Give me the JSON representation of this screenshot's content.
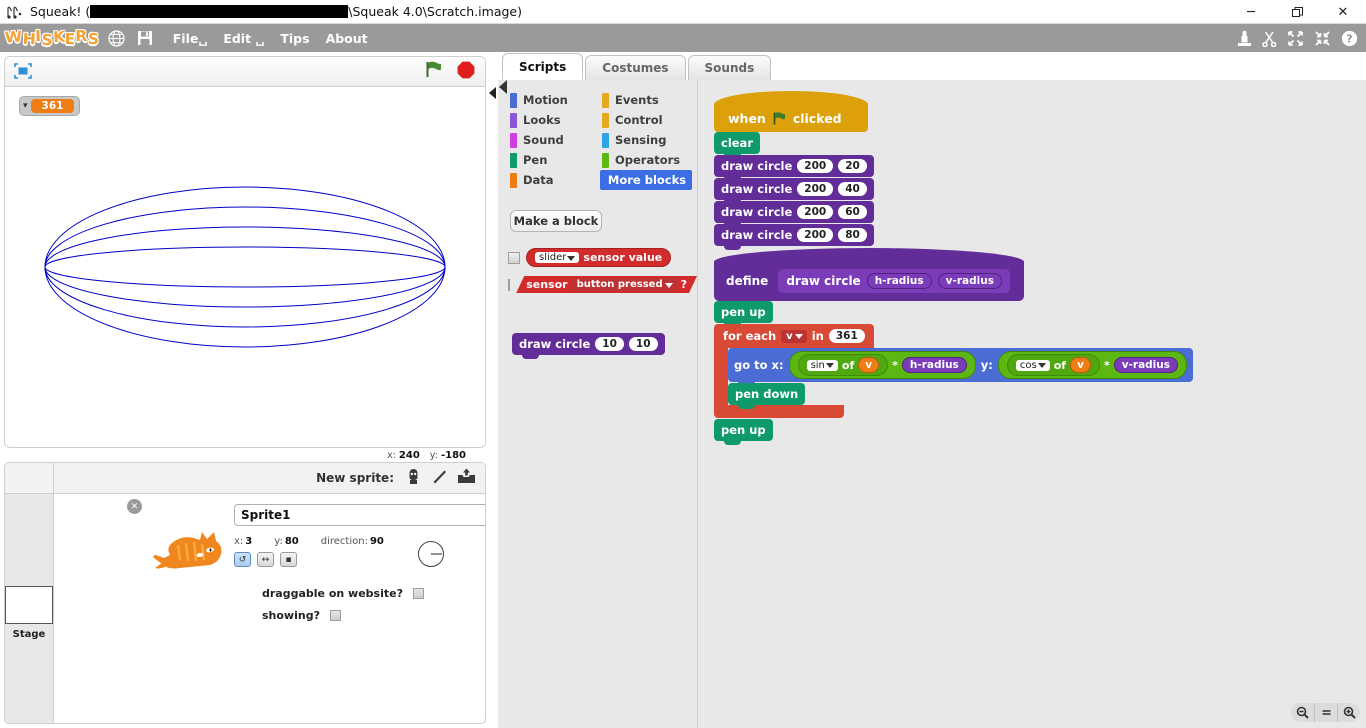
{
  "window": {
    "app_icon": "squeak-icon",
    "title_prefix": "Squeak! (",
    "title_redacted": "",
    "title_suffix": "\\Squeak 4.0\\Scratch.image)",
    "minimize": "─",
    "restore": "❐",
    "close": "✕"
  },
  "menubar": {
    "logo": "WHISKERS",
    "globe_icon": "globe-icon",
    "save_icon": "floppy-disk-icon",
    "items": [
      {
        "label": "File␣"
      },
      {
        "label": "Edit ␣"
      },
      {
        "label": "Tips"
      },
      {
        "label": "About"
      }
    ],
    "tools": [
      {
        "name": "stamp-icon"
      },
      {
        "name": "scissors-icon"
      },
      {
        "name": "grow-icon"
      },
      {
        "name": "shrink-icon"
      },
      {
        "name": "help-icon"
      }
    ]
  },
  "stage": {
    "presentation_icon": "presentation-mode-icon",
    "green_flag_icon": "green-flag-icon",
    "stop_icon": "stop-sign-icon",
    "watcher": {
      "arrow": "▾",
      "value": "361"
    },
    "mouse_x_label": "x:",
    "mouse_x": "240",
    "mouse_y_label": "y:",
    "mouse_y": "-180",
    "drawing": {
      "pen_color": "#0000c8",
      "h_radius": 200,
      "v_radii": [
        20,
        40,
        60,
        80
      ]
    }
  },
  "sprite_pane": {
    "stage_label": "Stage",
    "new_sprite_label": "New sprite:",
    "new_sprite_icons": [
      {
        "name": "paint-new-sprite-icon"
      },
      {
        "name": "choose-sprite-from-library-icon"
      },
      {
        "name": "upload-sprite-from-file-icon"
      }
    ],
    "delete_badge": "✕",
    "sprite": {
      "thumbnail": "cat-sprite",
      "name": "Sprite1",
      "x_label": "x:",
      "x_value": "3",
      "y_label": "y:",
      "y_value": "80",
      "direction_label": "direction:",
      "direction_value": "90",
      "rotation_styles": [
        {
          "name": "rotate-all-around",
          "glyph": "↺",
          "selected": true
        },
        {
          "name": "rotate-left-right",
          "glyph": "↔",
          "selected": false
        },
        {
          "name": "do-not-rotate",
          "glyph": "▪",
          "selected": false
        }
      ],
      "draggable_label": "draggable on website?",
      "draggable_checked": false,
      "showing_label": "showing?",
      "showing_checked": false
    }
  },
  "editor": {
    "tabs": [
      {
        "label": "Scripts",
        "active": true
      },
      {
        "label": "Costumes",
        "active": false
      },
      {
        "label": "Sounds",
        "active": false
      }
    ],
    "categories": [
      {
        "label": "Motion",
        "color": "#4a6cd4",
        "selected": false
      },
      {
        "label": "Events",
        "color": "#e6a81c",
        "selected": false
      },
      {
        "label": "Looks",
        "color": "#8a55d7",
        "selected": false
      },
      {
        "label": "Control",
        "color": "#e6a81c",
        "selected": false
      },
      {
        "label": "Sound",
        "color": "#cf3de3",
        "selected": false
      },
      {
        "label": "Sensing",
        "color": "#2ca5e2",
        "selected": false
      },
      {
        "label": "Pen",
        "color": "#0e9a6c",
        "selected": false
      },
      {
        "label": "Operators",
        "color": "#5cb712",
        "selected": false
      },
      {
        "label": "Data",
        "color": "#ee7d16",
        "selected": false
      },
      {
        "label": "More blocks",
        "color": "#632d99",
        "selected": true
      }
    ],
    "make_a_block": "Make a block",
    "palette_blocks": {
      "slider_sensor": {
        "dropdown": "slider",
        "text": "sensor value"
      },
      "sensor_pressed": {
        "prefix": "sensor",
        "dropdown": "button pressed",
        "suffix": "?"
      },
      "draw_circle": {
        "label": "draw circle",
        "arg1": "10",
        "arg2": "10"
      }
    },
    "zoom_controls": [
      {
        "name": "zoom-out-icon",
        "glyph": "⊖"
      },
      {
        "name": "zoom-reset-icon",
        "glyph": "="
      },
      {
        "name": "zoom-in-icon",
        "glyph": "⊕"
      }
    ],
    "scripts": {
      "script1": {
        "hat": {
          "when": "when",
          "flag": "green-flag-icon",
          "clicked": "clicked"
        },
        "clear": "clear",
        "draw_calls": [
          {
            "label": "draw circle",
            "arg1": "200",
            "arg2": "20"
          },
          {
            "label": "draw circle",
            "arg1": "200",
            "arg2": "40"
          },
          {
            "label": "draw circle",
            "arg1": "200",
            "arg2": "60"
          },
          {
            "label": "draw circle",
            "arg1": "200",
            "arg2": "80"
          }
        ]
      },
      "script2": {
        "define_label": "define",
        "proto_label": "draw circle",
        "param1": "h-radius",
        "param2": "v-radius",
        "pen_up": "pen up",
        "for_each": {
          "prefix": "for each",
          "var": "v",
          "in": "in",
          "count": "361"
        },
        "go_to": {
          "prefix": "go to x:",
          "x_fn": "sin",
          "x_of": "of",
          "x_var": "v",
          "x_mul": "*",
          "x_operand": "h-radius",
          "y_label": "y:",
          "y_fn": "cos",
          "y_of": "of",
          "y_var": "v",
          "y_mul": "*",
          "y_operand": "v-radius"
        },
        "pen_down": "pen down",
        "pen_up_end": "pen up"
      }
    }
  }
}
